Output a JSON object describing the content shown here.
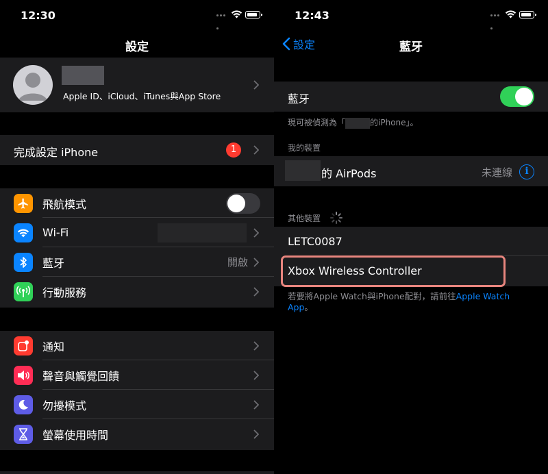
{
  "left": {
    "status_time": "12:30",
    "nav_title": "設定",
    "profile_subtitle": "Apple ID、iCloud、iTunes與App Store",
    "finish_setup_label": "完成設定 iPhone",
    "finish_setup_badge": "1",
    "group1": [
      {
        "label": "飛航模式",
        "icon": "airplane-icon",
        "color": "#ff9500"
      },
      {
        "label": "Wi-Fi",
        "icon": "wifi-icon",
        "color": "#0a84ff"
      },
      {
        "label": "藍牙",
        "icon": "bluetooth-icon",
        "color": "#0a84ff",
        "value": "開啟"
      },
      {
        "label": "行動服務",
        "icon": "cellular-icon",
        "color": "#30d158"
      }
    ],
    "group2": [
      {
        "label": "通知",
        "icon": "notifications-icon",
        "color": "#ff3b30"
      },
      {
        "label": "聲音與觸覺回饋",
        "icon": "sounds-icon",
        "color": "#ff2d55"
      },
      {
        "label": "勿擾模式",
        "icon": "moon-icon",
        "color": "#5e5ce6"
      },
      {
        "label": "螢幕使用時間",
        "icon": "hourglass-icon",
        "color": "#5e5ce6"
      }
    ]
  },
  "right": {
    "status_time": "12:43",
    "back_label": "設定",
    "nav_title": "藍牙",
    "bluetooth_label": "藍牙",
    "discoverable_prefix": "現可被偵測為「",
    "discoverable_suffix": "的iPhone」。",
    "my_devices_header": "我的裝置",
    "airpods_name": "的 AirPods",
    "airpods_status": "未連線",
    "other_devices_header": "其他裝置",
    "other_devices": [
      "LETC0087",
      "Xbox Wireless Controller"
    ],
    "footer_text": "若要將Apple Watch與iPhone配對，請前往",
    "footer_link": "Apple Watch App",
    "footer_end": "。"
  }
}
